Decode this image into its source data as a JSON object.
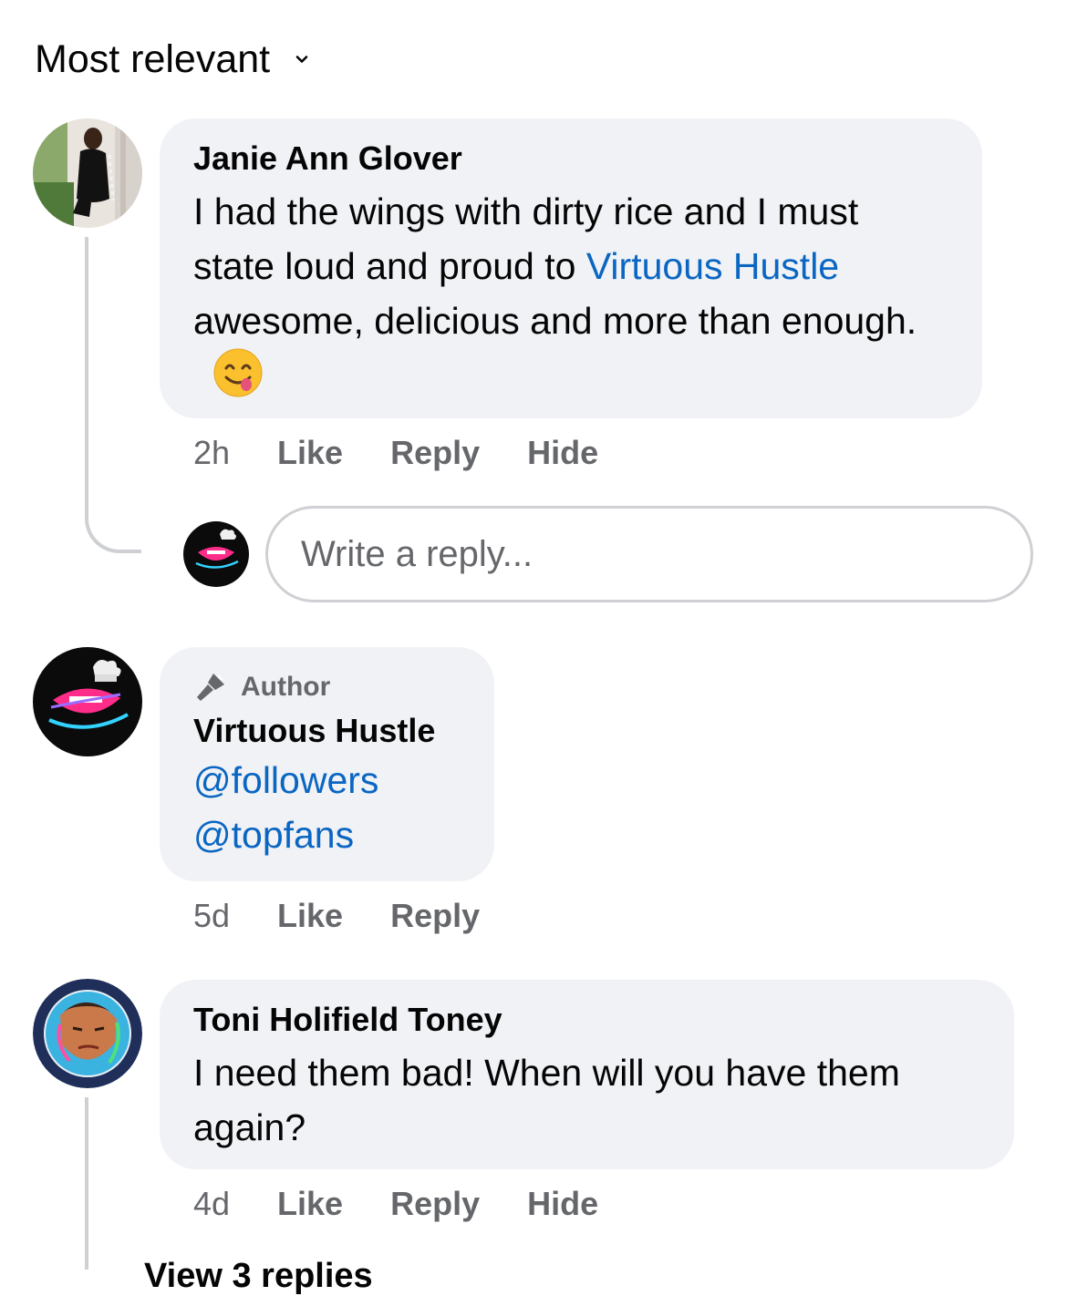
{
  "sort": {
    "label": "Most relevant"
  },
  "reply_box": {
    "placeholder": "Write a reply..."
  },
  "comments": [
    {
      "name": "Janie Ann Glover",
      "text_before": "I had the wings with dirty rice and I must state loud and proud to ",
      "mention": "Virtuous Hustle",
      "text_after": " awesome, delicious and more than enough.",
      "emoji": "face-savoring-food-emoji",
      "time": "2h",
      "actions": [
        "Like",
        "Reply",
        "Hide"
      ]
    },
    {
      "badge": "Author",
      "name": "Virtuous Hustle",
      "tags": [
        "@followers",
        "@topfans"
      ],
      "time": "5d",
      "actions": [
        "Like",
        "Reply"
      ]
    },
    {
      "name": "Toni Holifield Toney",
      "text": "I need them bad! When will you have them again?",
      "time": "4d",
      "actions": [
        "Like",
        "Reply",
        "Hide"
      ]
    }
  ],
  "more_replies_label": "View 3 replies",
  "colors": {
    "bubble": "#f0f2f5",
    "link": "#0a66c2",
    "secondary": "#65676b",
    "thread": "#ced0d4"
  }
}
